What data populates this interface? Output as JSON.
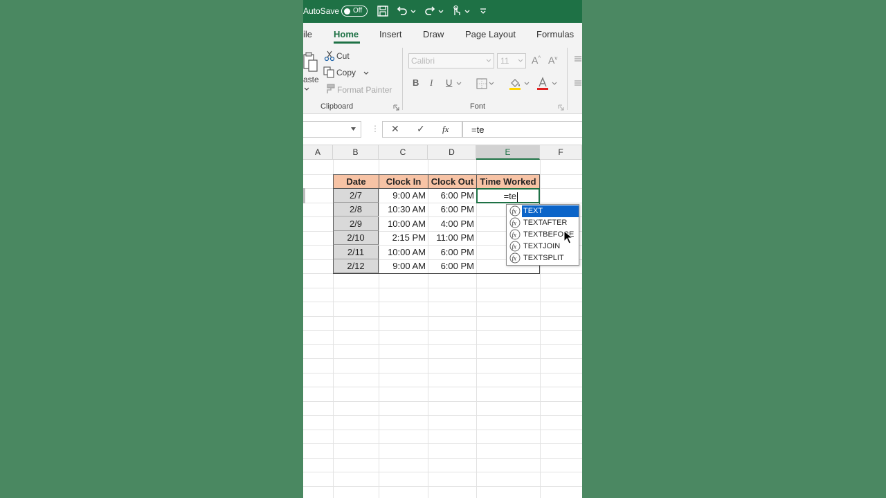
{
  "titlebar": {
    "autosave_label": "AutoSave",
    "autosave_state": "Off"
  },
  "tabs": [
    "ile",
    "Home",
    "Insert",
    "Draw",
    "Page Layout",
    "Formulas"
  ],
  "active_tab": "Home",
  "ribbon": {
    "clipboard": {
      "paste_label": "aste",
      "cut_label": "Cut",
      "copy_label": "Copy",
      "format_painter_label": "Format Painter",
      "group_label": "Clipboard"
    },
    "font": {
      "font_name": "Calibri",
      "font_size": "11",
      "bold": "B",
      "italic": "I",
      "underline": "U",
      "group_label": "Font"
    }
  },
  "formula_bar": {
    "cancel_symbol": "✕",
    "enter_symbol": "✓",
    "fx_label": "fx",
    "value": "=te"
  },
  "columns": [
    "A",
    "B",
    "C",
    "D",
    "E",
    "F"
  ],
  "table": {
    "headers": [
      "Date",
      "Clock In",
      "Clock Out",
      "Time Worked"
    ],
    "rows": [
      {
        "date": "2/7",
        "clock_in": "9:00 AM",
        "clock_out": "6:00 PM"
      },
      {
        "date": "2/8",
        "clock_in": "10:30 AM",
        "clock_out": "6:00 PM"
      },
      {
        "date": "2/9",
        "clock_in": "10:00 AM",
        "clock_out": "4:00 PM"
      },
      {
        "date": "2/10",
        "clock_in": "2:15 PM",
        "clock_out": "11:00 PM"
      },
      {
        "date": "2/11",
        "clock_in": "10:00 AM",
        "clock_out": "6:00 PM"
      },
      {
        "date": "2/12",
        "clock_in": "9:00 AM",
        "clock_out": "6:00 PM"
      }
    ],
    "active_cell_value": "=te"
  },
  "autocomplete": {
    "items": [
      "TEXT",
      "TEXTAFTER",
      "TEXTBEFORE",
      "TEXTJOIN",
      "TEXTSPLIT"
    ],
    "selected": "TEXT"
  },
  "colors": {
    "title_green": "#1e7145",
    "header_fill": "#f7c3a5",
    "date_fill": "#d9d9d9",
    "selection_blue": "#0b64c8",
    "background": "#4a8760"
  }
}
